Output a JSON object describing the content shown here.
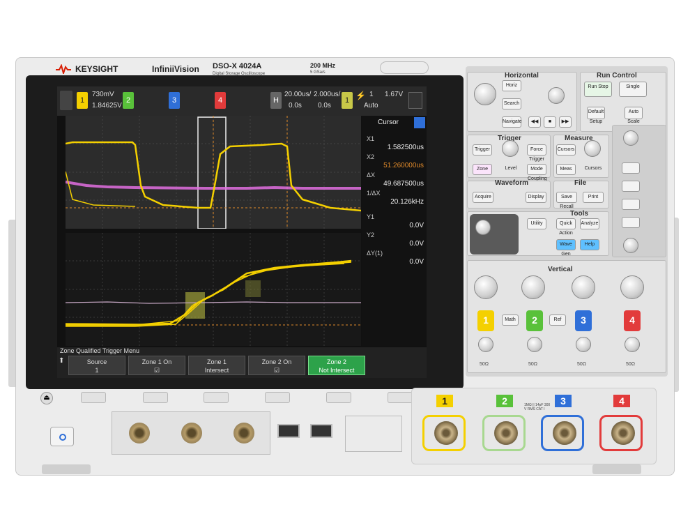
{
  "header": {
    "brand": "KEYSIGHT",
    "series": "InfiniiVision",
    "model": "DSO-X 4024A",
    "model_sub": "Digital Storage Oscilloscope",
    "bandwidth": "200 MHz",
    "sample_rate": "5 GSa/s"
  },
  "screen": {
    "topbar": {
      "ch1_scale": "730mV",
      "ch1_offset": "1.84625V",
      "ch_labels": [
        "1",
        "2",
        "3",
        "4"
      ],
      "h_label": "H",
      "time_div": "20.00us/",
      "delay": "2.000us/",
      "t0_a": "0.0s",
      "t0_b": "0.0s",
      "trig_count": "1",
      "trig_level": "1.67V",
      "trig_mode": "Auto"
    },
    "side_panel": {
      "title": "Cursor",
      "rows": [
        {
          "label": "X1",
          "value": "1.582500us"
        },
        {
          "label": "X2",
          "value": "51.260000us"
        },
        {
          "label": "ΔX",
          "value": "49.687500us"
        },
        {
          "label": "1/ΔX",
          "value": "20.126kHz"
        },
        {
          "label": "Y1",
          "value": "0.0V"
        },
        {
          "label": "Y2",
          "value": "0.0V"
        },
        {
          "label": "ΔY(1)",
          "value": "0.0V"
        }
      ]
    },
    "menu": {
      "title": "Zone Qualified Trigger Menu",
      "softkeys": [
        {
          "top": "Source",
          "bottom": "1"
        },
        {
          "top": "Zone 1 On",
          "bottom": "☑"
        },
        {
          "top": "Zone 1",
          "bottom": "Intersect"
        },
        {
          "top": "Zone 2 On",
          "bottom": "☑"
        },
        {
          "top": "Zone 2",
          "bottom": "Not Intersect"
        }
      ]
    }
  },
  "panel": {
    "horizontal": {
      "title": "Horizontal",
      "buttons": [
        "Horiz",
        "Search",
        "Navigate"
      ]
    },
    "run_control": {
      "title": "Run Control",
      "buttons": [
        "Run Stop",
        "Single",
        "Default Setup",
        "Auto Scale"
      ]
    },
    "trigger": {
      "title": "Trigger",
      "buttons": [
        "Trigger",
        "Force Trigger",
        "Zone",
        "Level",
        "Mode Coupling"
      ]
    },
    "measure": {
      "title": "Measure",
      "buttons": [
        "Cursors",
        "Meas",
        "Cursors"
      ]
    },
    "waveform": {
      "title": "Waveform",
      "buttons": [
        "Acquire",
        "Display"
      ]
    },
    "file": {
      "title": "File",
      "buttons": [
        "Save Recall",
        "Print"
      ]
    },
    "tools": {
      "title": "Tools",
      "buttons": [
        "Utility",
        "Quick Action",
        "Analyze",
        "Wave Gen",
        "Help"
      ]
    },
    "vertical": {
      "title": "Vertical",
      "channels": [
        "1",
        "2",
        "3",
        "4"
      ],
      "math_label": "Math",
      "ref_label": "Ref",
      "impedance": [
        "50Ω",
        "50Ω",
        "50Ω",
        "50Ω"
      ]
    }
  },
  "front": {
    "input_labels": [
      "1",
      "2",
      "3",
      "4"
    ],
    "input_warning": "1MΩ || 14pF 300 V RMS CAT I",
    "colors": {
      "ch1": "#f4d000",
      "ch2": "#59c13a",
      "ch3": "#2f6fd8",
      "ch4": "#e23b3b",
      "bg_trace2": "#e26ee0"
    }
  }
}
